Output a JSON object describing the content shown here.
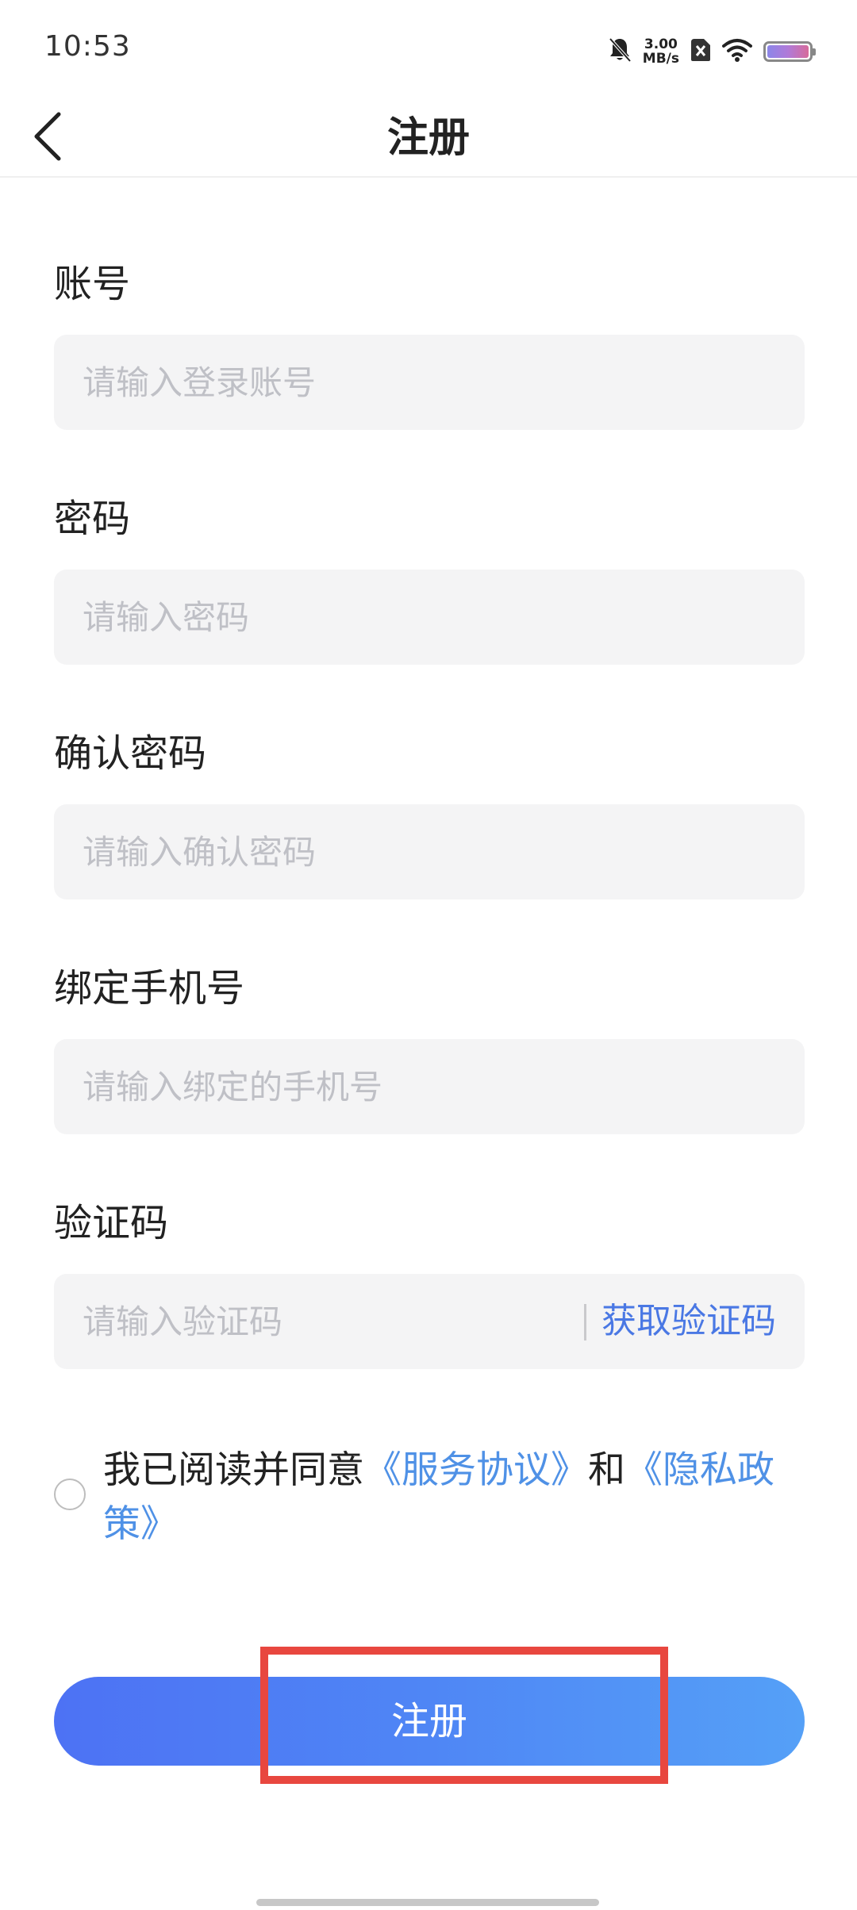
{
  "status_bar": {
    "time": "10:53",
    "net_speed_value": "3.00",
    "net_speed_unit": "MB/s",
    "icons": [
      "bell-muted-icon",
      "sim-blocked-icon",
      "wifi-icon",
      "battery-icon"
    ]
  },
  "header": {
    "title": "注册",
    "back_icon": "chevron-left-icon"
  },
  "form": {
    "account": {
      "label": "账号",
      "placeholder": "请输入登录账号"
    },
    "password": {
      "label": "密码",
      "placeholder": "请输入密码"
    },
    "confirm_password": {
      "label": "确认密码",
      "placeholder": "请输入确认密码"
    },
    "phone": {
      "label": "绑定手机号",
      "placeholder": "请输入绑定的手机号"
    },
    "code": {
      "label": "验证码",
      "placeholder": "请输入验证码",
      "get_code_label": "获取验证码"
    }
  },
  "agreement": {
    "prefix": "我已阅读并同意",
    "service_link": "《服务协议》",
    "and": "和",
    "privacy_link": "《隐私政策》"
  },
  "register_button": {
    "label": "注册"
  },
  "colors": {
    "accent": "#4a78e4",
    "link": "#4f91e6",
    "button_gradient_start": "#4d72f4",
    "button_gradient_end": "#55a0f7",
    "highlight": "#e8473f"
  }
}
